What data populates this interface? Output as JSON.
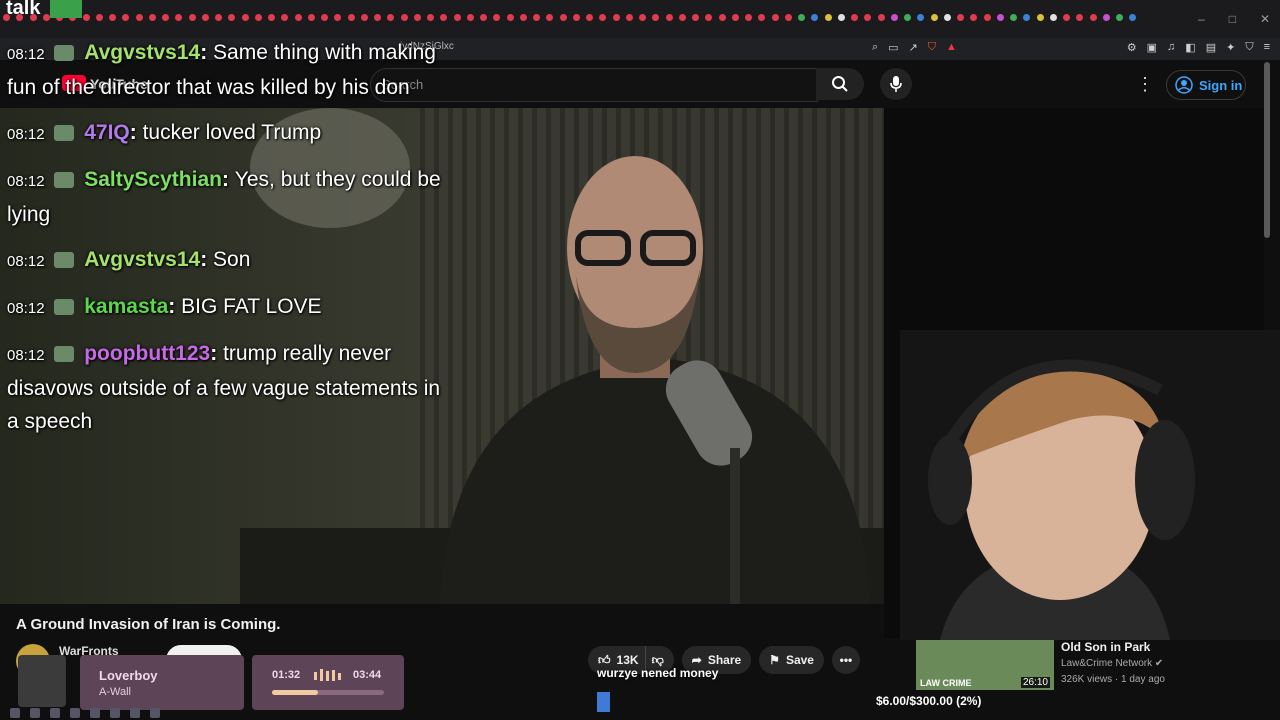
{
  "browser": {
    "overlay_label": "talk",
    "url": "jvdNzSiGlxc",
    "window_controls": [
      "–",
      "□",
      "✕"
    ]
  },
  "youtube": {
    "logo_text": "YouTube",
    "search_placeholder": "Search",
    "sign_in": "Sign in"
  },
  "chat": [
    {
      "time": "08:12",
      "user": "Avgvstvs14",
      "user_color": "#a4e26a",
      "text": "Same thing with making fun of the director that was killed by his don"
    },
    {
      "time": "08:12",
      "user": "47IQ",
      "user_color": "#b07ae8",
      "text": "tucker loved Trump"
    },
    {
      "time": "08:12",
      "user": "SaltyScythian",
      "user_color": "#7ee062",
      "text": "Yes, but they could be lying"
    },
    {
      "time": "08:12",
      "user": "Avgvstvs14",
      "user_color": "#a4e26a",
      "text": "Son"
    },
    {
      "time": "08:12",
      "user": "kamasta",
      "user_color": "#5ed64c",
      "text": "BIG FAT LOVE"
    },
    {
      "time": "08:12",
      "user": "poopbutt123",
      "user_color": "#c86ae8",
      "text": "trump really never disavows outside of a few vague statements in a speech"
    }
  ],
  "video": {
    "title": "A Ground Invasion of Iran is Coming.",
    "channel": "WarFronts",
    "likes": "13K",
    "share_label": "Share",
    "save_label": "Save",
    "caption": "wurzye nened money"
  },
  "recommendation": {
    "title": "Old Son in Park",
    "channel": "Law&Crime Network",
    "meta": "326K views · 1 day ago",
    "duration": "26:10",
    "thumb_label": "LAW CRIME"
  },
  "music": {
    "title": "Loverboy",
    "artist": "A-Wall",
    "current_time": "01:32",
    "total_time": "03:44",
    "progress": 0.41
  },
  "donation_goal": {
    "text": "$6.00/$300.00 (2%)",
    "fraction": 0.02
  },
  "colors": {
    "accent_blue": "#3ea6ff",
    "youtube_red": "#ff0033",
    "goal_blue": "#3f7bd6",
    "music_card": "#5d4457"
  }
}
